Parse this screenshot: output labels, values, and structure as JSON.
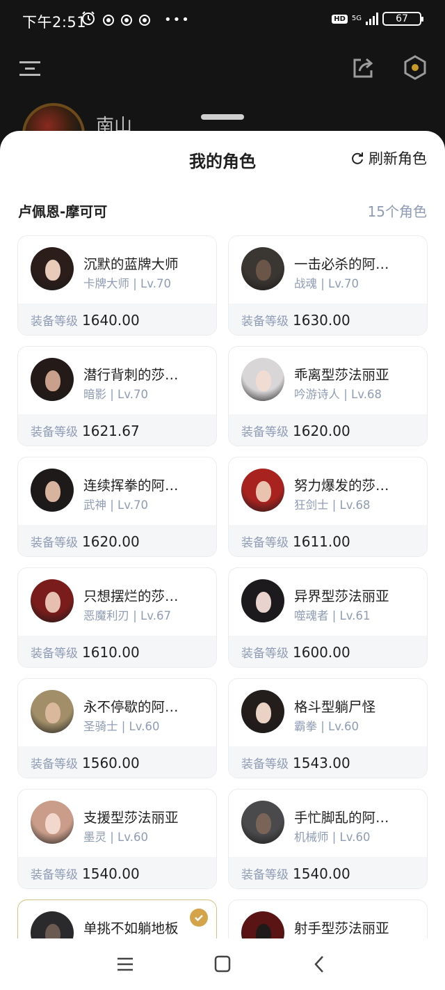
{
  "status_bar": {
    "time": "下午2:51",
    "hd": "HD",
    "network": "5G",
    "battery": "67",
    "more": "•••"
  },
  "header": {
    "username": "南山"
  },
  "sheet": {
    "title": "我的角色",
    "refresh_label": "刷新角色",
    "account": "卢佩恩-摩可可",
    "role_count": "15个角色",
    "gear_label": "装备等级"
  },
  "characters": [
    {
      "name": "沉默的蓝牌大师",
      "sub": "卡牌大师 | Lv.70",
      "gear": "1640.00",
      "hair": "#2b1d1a",
      "skin": "#e8cbb9"
    },
    {
      "name": "一击必杀的阿…",
      "sub": "战魂 | Lv.70",
      "gear": "1630.00",
      "hair": "#3a3632",
      "skin": "#6b5448"
    },
    {
      "name": "潜行背刺的莎…",
      "sub": "暗影 | Lv.70",
      "gear": "1621.67",
      "hair": "#241a18",
      "skin": "#c9a08c"
    },
    {
      "name": "乖离型莎法丽亚",
      "sub": "吟游诗人 | Lv.68",
      "gear": "1620.00",
      "hair": "#d9d6d8",
      "skin": "#f0dcd2"
    },
    {
      "name": "连续挥拳的阿…",
      "sub": "武神 | Lv.70",
      "gear": "1620.00",
      "hair": "#1e1a1a",
      "skin": "#d8b49f"
    },
    {
      "name": "努力爆发的莎…",
      "sub": "狂剑士 | Lv.68",
      "gear": "1611.00",
      "hair": "#a8231f",
      "skin": "#eac2b0"
    },
    {
      "name": "只想摆烂的莎…",
      "sub": "恶魔利刃 | Lv.67",
      "gear": "1610.00",
      "hair": "#7a1c1c",
      "skin": "#e6bfb0"
    },
    {
      "name": "异界型莎法丽亚",
      "sub": "噬魂者 | Lv.61",
      "gear": "1600.00",
      "hair": "#1d1a1e",
      "skin": "#e9d3cf"
    },
    {
      "name": "永不停歇的阿…",
      "sub": "圣骑士 | Lv.60",
      "gear": "1560.00",
      "hair": "#a28f6a",
      "skin": "#d9b89c"
    },
    {
      "name": "格斗型躺尸怪",
      "sub": "霸拳 | Lv.60",
      "gear": "1543.00",
      "hair": "#231d1c",
      "skin": "#ead2c4"
    },
    {
      "name": "支援型莎法丽亚",
      "sub": "墨灵 | Lv.60",
      "gear": "1540.00",
      "hair": "#c99d8a",
      "skin": "#f2d8cc"
    },
    {
      "name": "手忙脚乱的阿…",
      "sub": "机械师 | Lv.60",
      "gear": "1540.00",
      "hair": "#4a4a4c",
      "skin": "#7a6458"
    },
    {
      "name": "单挑不如躺地板",
      "sub": "",
      "gear": "",
      "hair": "#2a2a2c",
      "skin": "#6a5a52",
      "selected": true
    },
    {
      "name": "射手型莎法丽亚",
      "sub": "",
      "gear": "",
      "hair": "#5a1414",
      "skin": "#1e1a1a"
    }
  ],
  "colors": {
    "accent": "#d4a44a",
    "muted": "#8f9cb5",
    "card_bottom": "#f5f6f8"
  }
}
